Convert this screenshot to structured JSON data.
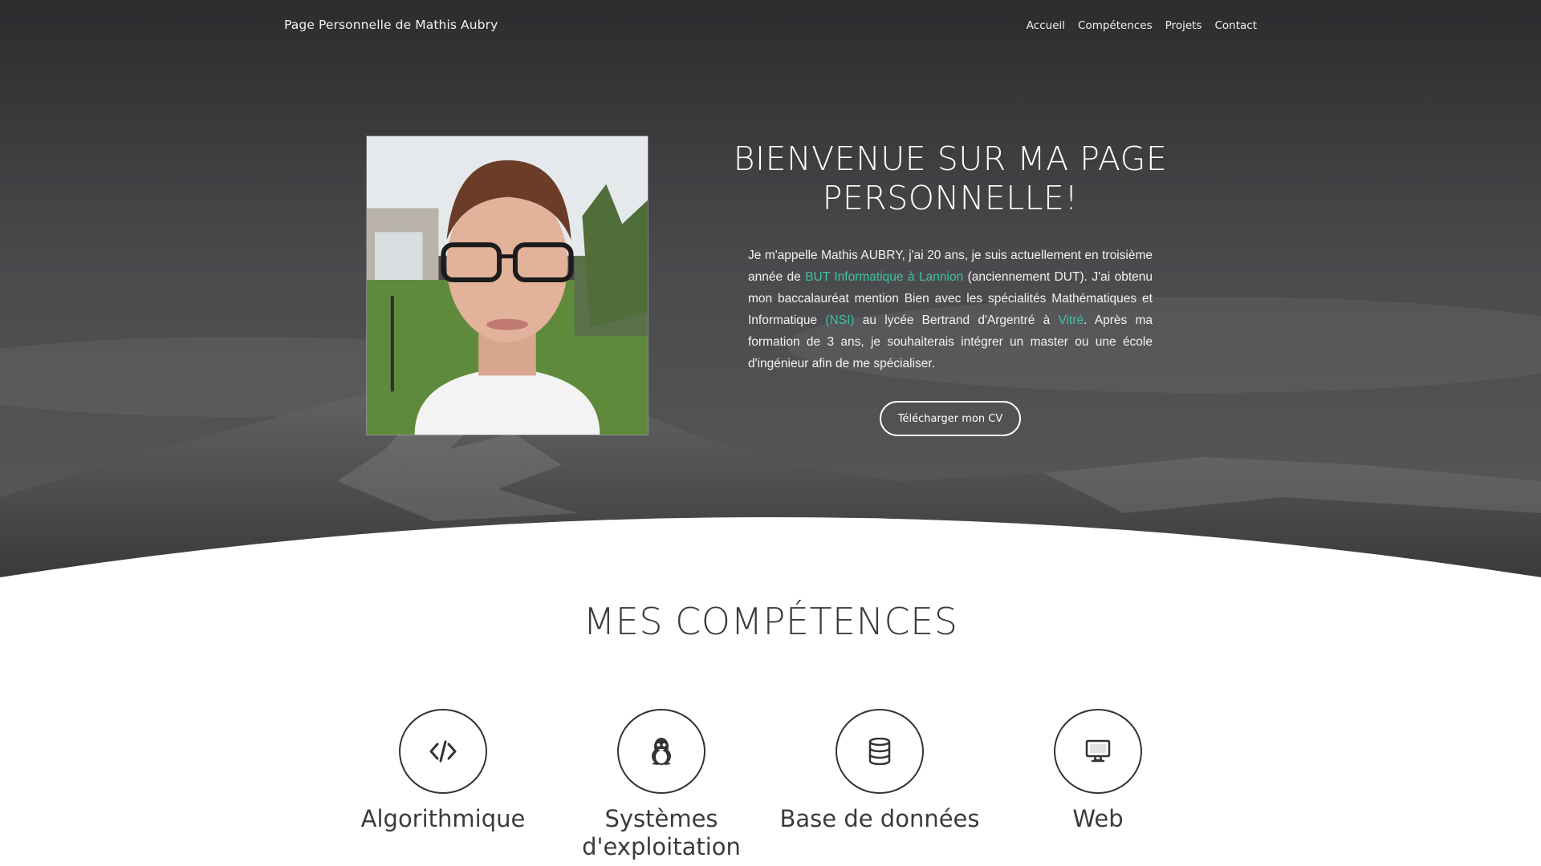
{
  "nav": {
    "brand": "Page Personnelle de Mathis Aubry",
    "links": [
      "Accueil",
      "Compétences",
      "Projets",
      "Contact"
    ]
  },
  "hero": {
    "title": "BIENVENUE SUR MA PAGE PERSONNELLE!",
    "intro_1": "Je m'appelle Mathis AUBRY, j'ai 20 ans, je suis actuellement en troisième année de ",
    "link_but": "BUT Informatique à Lannion",
    "intro_2": " (anciennement DUT). J'ai obtenu mon baccalauréat mention Bien avec les spécialités Mathématiques et Informatique ",
    "link_nsi": "(NSI)",
    "intro_3": " au lycée Bertrand d'Argentré à ",
    "link_vitre": "Vitré",
    "intro_4": ". Après ma formation de 3 ans, je souhaiterais intégrer un master ou une école d'ingénieur afin de me spécialiser.",
    "cv_button": "Télécharger mon CV",
    "accent_color": "#3cc3a0"
  },
  "skills": {
    "title": "MES COMPÉTENCES",
    "items": [
      {
        "label": "Algorithmique",
        "icon": "code-icon"
      },
      {
        "label": "Systèmes d'exploitation",
        "icon": "linux-icon"
      },
      {
        "label": "Base de données",
        "icon": "database-icon"
      },
      {
        "label": "Web",
        "icon": "desktop-icon"
      }
    ]
  }
}
